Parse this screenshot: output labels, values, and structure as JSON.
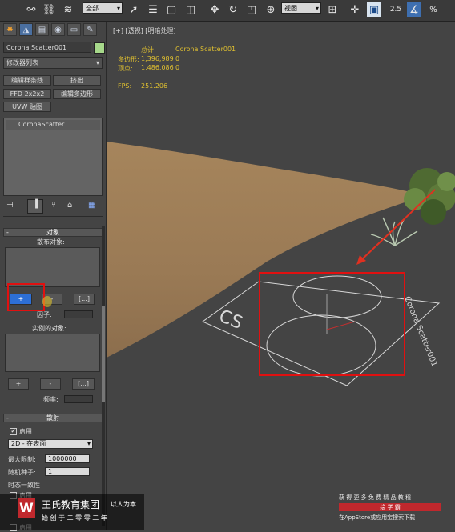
{
  "toolbar": {
    "selection_filter": "全部",
    "reference_coord": "视图",
    "snap_toggle_label": "2.5",
    "percent_snap_label": "%",
    "icons": [
      "link-icon",
      "unlink-icon",
      "bind-spacewarp-icon",
      "select-icon",
      "select-by-name-icon",
      "rect-region-icon",
      "window-crossing-icon",
      "move-icon",
      "rotate-icon",
      "scale-icon",
      "place-icon",
      "pivot-icon",
      "select-manipulate-icon",
      "snap-icon",
      "angle-snap-icon",
      "percent-snap-icon"
    ]
  },
  "command_panel": {
    "tabs": [
      "create-tab",
      "modify-tab",
      "hierarchy-tab",
      "motion-tab",
      "display-tab",
      "utilities-tab"
    ],
    "object_name": "Corona Scatter001",
    "object_color": "#a6d88a",
    "modifier_list": "修改器列表",
    "modifier_buttons": [
      "编辑样条线",
      "挤出",
      "FFD 2x2x2",
      "编辑多边形",
      "UVW 贴图"
    ],
    "stack_item": "CoronaScatter",
    "stack_tools": [
      "pin-stack-icon",
      "show-end-result-icon",
      "make-unique-icon",
      "remove-modifier-icon",
      "configure-sets-icon"
    ]
  },
  "objects_rollout": {
    "title": "对象",
    "distribute_label": "散布对象:",
    "add_label": "+",
    "remove_label": "-",
    "more_label": "[...]",
    "factor_label": "因子:",
    "instance_label": "实例的对象:",
    "freq_label": "频率:"
  },
  "scatter_rollout": {
    "title": "散射",
    "enable_label": "启用",
    "mode_value": "2D - 在表面",
    "max_limit_label": "最大限制:",
    "max_limit_value": "1000000",
    "random_seed_label": "随机种子:",
    "random_seed_value": "1",
    "time_consistency_label": "时态一致性",
    "enable2_label": "启用",
    "enable3_label": "启用"
  },
  "viewport": {
    "label": "[+] [透视] [明暗处理]",
    "stats_total_header": "总计",
    "stats_object_header": "Corona Scatter001",
    "polys_label": "多边形:",
    "polys_total": "1,396,989",
    "polys_object": "0",
    "verts_label": "顶点:",
    "verts_total": "1,486,086",
    "verts_object": "0",
    "fps_label": "FPS:",
    "fps_value": "251.206",
    "gizmo_text_1": "CS",
    "gizmo_text_2": "Corona Scatter001",
    "terrain_color": "#ab8c65"
  },
  "watermark": {
    "brand": "王氏教育集团",
    "slogan": "以人为本",
    "tagline": "始 创 于 二 零 零 二 年",
    "promo_line1": "获 得 更 多 免 费 精 品 教 程",
    "promo_line2": "绘 学 霸",
    "promo_line3": "在AppStore或应用宝搜索下载"
  },
  "colors": {
    "highlight": "#e01010",
    "add_button": "#2d6fd6",
    "arrow": "#e03020"
  }
}
